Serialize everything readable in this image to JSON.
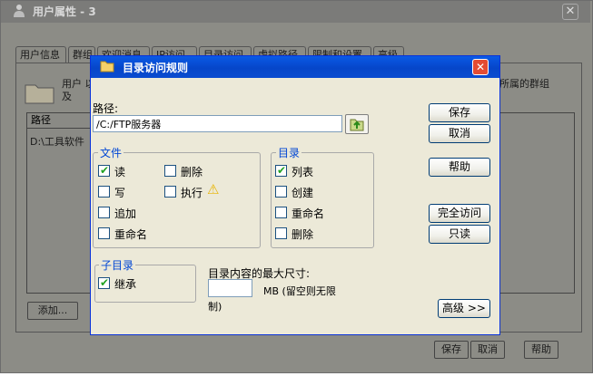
{
  "outer": {
    "title": "用户属性 - 3",
    "close_glyph": "✕",
    "tabs": [
      "用户信息",
      "群组",
      "欢迎消息",
      "IP访问",
      "目录访问",
      "虚拟路径",
      "限制和设置",
      "高级"
    ],
    "desc_left": "用户 以及",
    "desc_right": "所属的群组",
    "list_header": "路径",
    "list_row": "D:\\工具软件",
    "add_button": "添加...",
    "save_button": "保存",
    "cancel_button": "取消",
    "help_button": "帮助"
  },
  "dialog": {
    "title": "目录访问规则",
    "close_glyph": "✕",
    "path_label": "路径:",
    "path_value": "/C:/FTP服务器",
    "files_group": {
      "legend": "文件",
      "items": [
        {
          "label": "读",
          "checked": true
        },
        {
          "label": "删除",
          "checked": false
        },
        {
          "label": "写",
          "checked": false
        },
        {
          "label": "执行",
          "checked": false
        },
        {
          "label": "追加",
          "checked": false
        },
        {
          "label": "重命名",
          "checked": false
        }
      ]
    },
    "dirs_group": {
      "legend": "目录",
      "items": [
        {
          "label": "列表",
          "checked": true
        },
        {
          "label": "创建",
          "checked": false
        },
        {
          "label": "重命名",
          "checked": false
        },
        {
          "label": "删除",
          "checked": false
        }
      ]
    },
    "subdir_group": {
      "legend": "子目录",
      "items": [
        {
          "label": "继承",
          "checked": true
        }
      ]
    },
    "max_size_label": "目录内容的最大尺寸:",
    "max_size_value": "",
    "max_size_unit": "MB (留空则无限",
    "max_size_unit_cont": "制)",
    "buttons": {
      "save": "保存",
      "cancel": "取消",
      "help": "帮助",
      "full_access": "完全访问",
      "read_only": "只读",
      "advanced": "高级 >>"
    },
    "check_glyph": "✔",
    "warning_glyph": "⚠"
  },
  "colors": {
    "title_blue": "#0a5ae6",
    "dialog_bg": "#ece9d8",
    "group_legend": "#0046d5",
    "check_green": "#21a121",
    "warning": "#e8b400"
  }
}
